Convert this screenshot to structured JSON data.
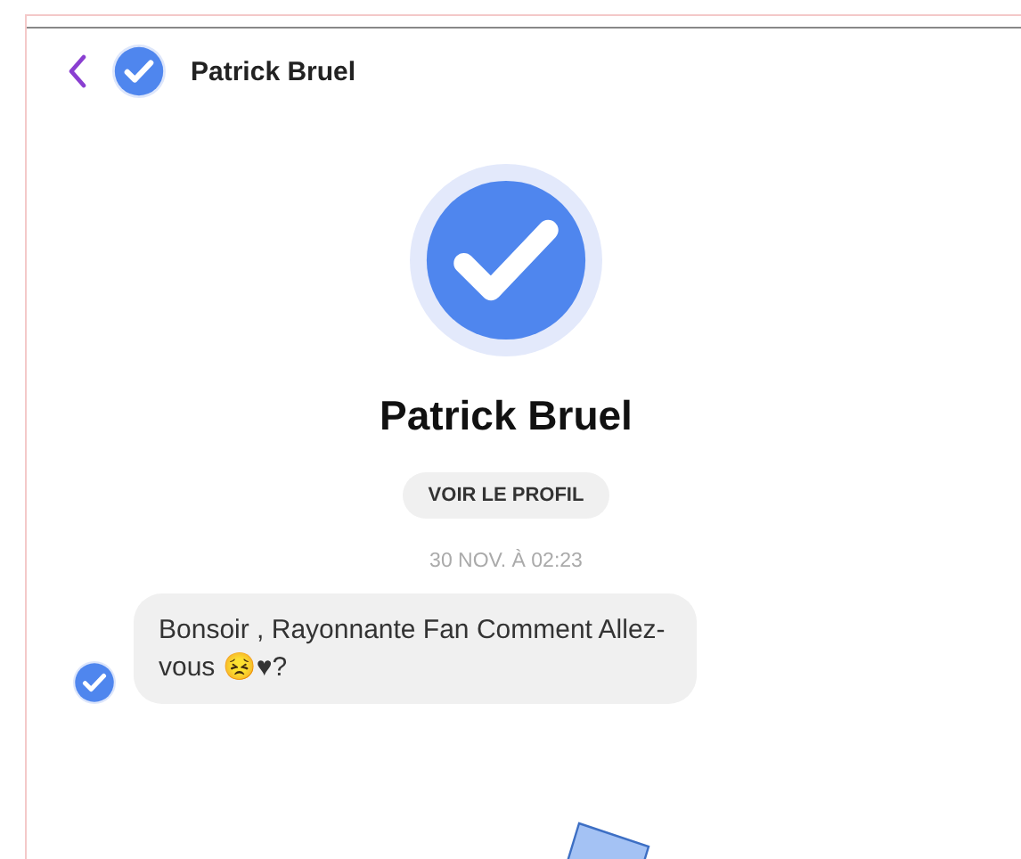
{
  "header": {
    "title": "Patrick Bruel"
  },
  "profile": {
    "name": "Patrick Bruel",
    "button": "VOIR LE PROFIL",
    "timestamp": "30 NOV. À 02:23"
  },
  "messages": [
    {
      "text": "Bonsoir , Rayonnante Fan Comment Allez-vous 😣♥?"
    }
  ]
}
